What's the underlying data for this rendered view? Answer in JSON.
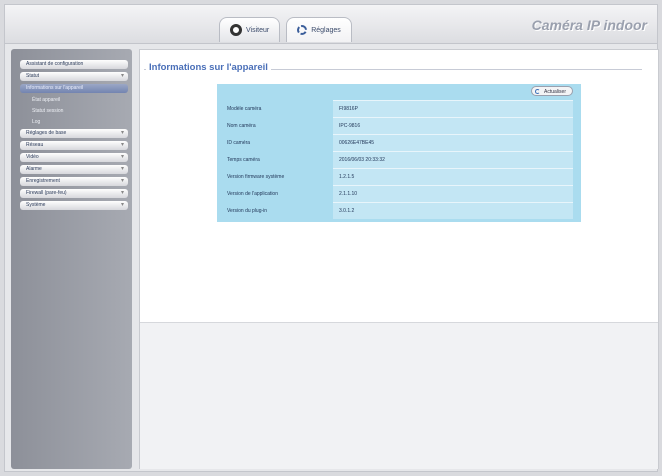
{
  "header": {
    "tabs": [
      {
        "label": "Visiteur",
        "icon": "camera-icon"
      },
      {
        "label": "Réglages",
        "icon": "settings-icon"
      }
    ],
    "brand": "Caméra IP indoor"
  },
  "sidebar": {
    "items": [
      {
        "label": "Assistant de configuration"
      },
      {
        "label": "Statut"
      },
      {
        "label": "Informations sur l'appareil",
        "active": true
      },
      {
        "label": "État appareil",
        "sub": true
      },
      {
        "label": "Statut session",
        "sub": true
      },
      {
        "label": "Log",
        "sub": true
      },
      {
        "label": "Réglages de base"
      },
      {
        "label": "Réseau"
      },
      {
        "label": "Vidéo"
      },
      {
        "label": "Alarme"
      },
      {
        "label": "Enregistrement"
      },
      {
        "label": "Firewall (pare-feu)"
      },
      {
        "label": "Système"
      }
    ]
  },
  "main": {
    "section_title": "Informations sur l'appareil",
    "refresh_label": "Actualiser",
    "rows": [
      {
        "label": "Modèle caméra",
        "value": "FI9816P"
      },
      {
        "label": "Nom caméra",
        "value": "IPC-9816"
      },
      {
        "label": "ID caméra",
        "value": "00626E47BE45"
      },
      {
        "label": "Temps caméra",
        "value": "2016/06/03 20:33:32"
      },
      {
        "label": "Version firmware système",
        "value": "1.2.1.5"
      },
      {
        "label": "Version de l'application",
        "value": "2.1.1.10"
      },
      {
        "label": "Version du plug-in",
        "value": "3.0.1.2"
      }
    ]
  }
}
